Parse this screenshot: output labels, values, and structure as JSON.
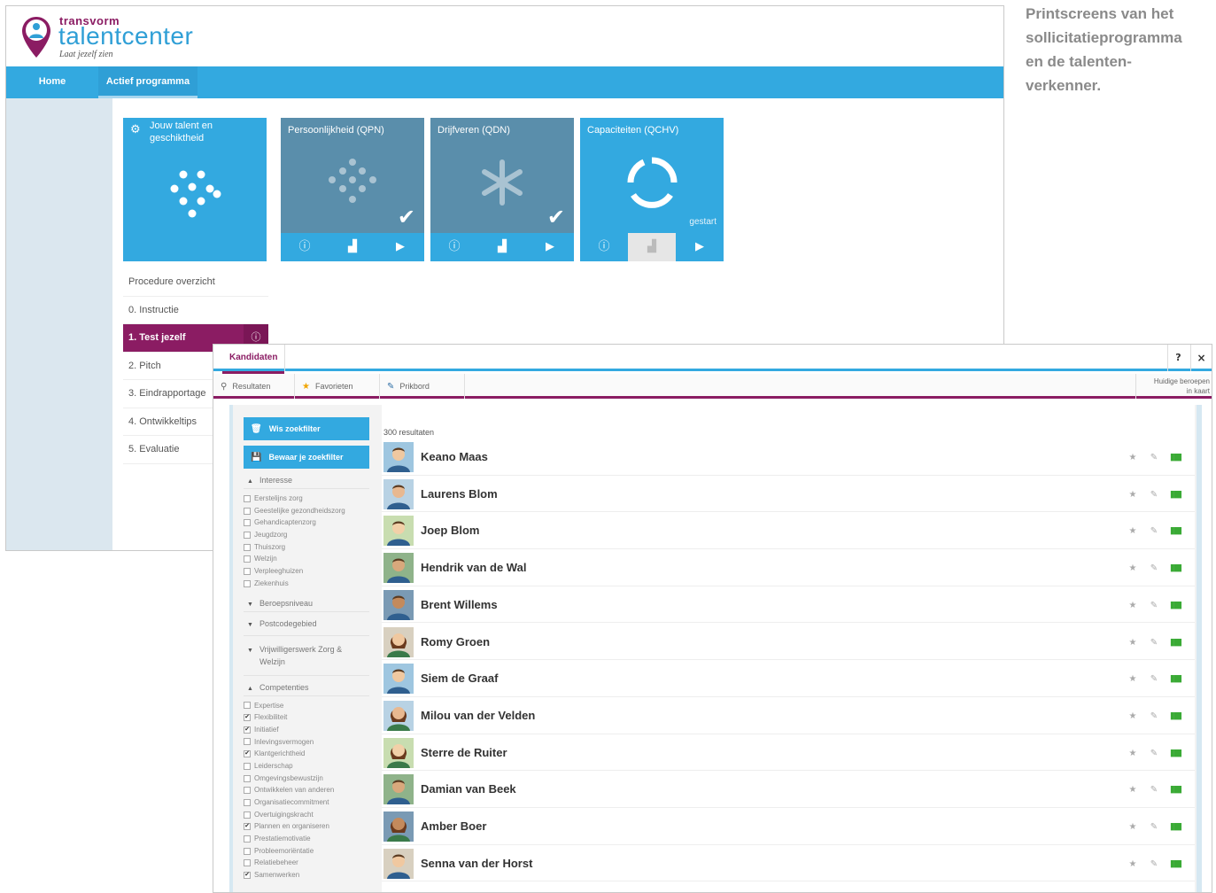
{
  "caption": {
    "lines": [
      "Printscreens van het",
      "sollicitatieprogramma",
      "en de talenten-",
      "verkenner."
    ]
  },
  "talentcenter": {
    "logo": {
      "small": "transvorm",
      "big": "talentcenter",
      "tagline": "Laat jezelf zien"
    },
    "nav": [
      {
        "label": "Home"
      },
      {
        "label": "Actief programma"
      }
    ],
    "main_tile": {
      "title": "Jouw talent en geschiktheid"
    },
    "tiles": [
      {
        "title": "Persoonlijkheid (QPN)",
        "status": "",
        "completed": true
      },
      {
        "title": "Drijfveren (QDN)",
        "status": "",
        "completed": true
      },
      {
        "title": "Capaciteiten (QCHV)",
        "status": "gestart",
        "completed": false
      }
    ],
    "steps": [
      {
        "label": "Procedure overzicht"
      },
      {
        "label": "0. Instructie"
      },
      {
        "label": "1. Test jezelf"
      },
      {
        "label": "2. Pitch"
      },
      {
        "label": "3. Eindrapportage"
      },
      {
        "label": "4. Ontwikkeltips"
      },
      {
        "label": "5. Evaluatie"
      }
    ],
    "colors": {
      "accent": "#33a9e0",
      "brand": "#8b1c63",
      "tile_done": "#5a8eab"
    }
  },
  "kandidaten": {
    "tab": "Kandidaten",
    "help": "?",
    "close": "×",
    "subtabs": [
      {
        "label": "Resultaten",
        "icon": "search-icon"
      },
      {
        "label": "Favorieten",
        "icon": "star-icon"
      },
      {
        "label": "Prikbord",
        "icon": "pin-icon"
      }
    ],
    "huidige": [
      "Huidige beroepen",
      "in kaart"
    ],
    "buttons": {
      "clear": "Wis zoekfilter",
      "save": "Bewaar je zoekfilter"
    },
    "filters": {
      "interesse": {
        "title": "Interesse",
        "items": [
          {
            "label": "Eerstelijns zorg",
            "checked": false
          },
          {
            "label": "Geestelijke gezondheidszorg",
            "checked": false
          },
          {
            "label": "Gehandicaptenzorg",
            "checked": false
          },
          {
            "label": "Jeugdzorg",
            "checked": false
          },
          {
            "label": "Thuiszorg",
            "checked": false
          },
          {
            "label": "Welzijn",
            "checked": false
          },
          {
            "label": "Verpleeghuizen",
            "checked": false
          },
          {
            "label": "Ziekenhuis",
            "checked": false
          }
        ]
      },
      "beroepsniveau": {
        "title": "Beroepsniveau"
      },
      "postcodegebied": {
        "title": "Postcodegebied"
      },
      "vrijwilligerswerk": {
        "title": "Vrijwilligerswerk Zorg & Welzijn"
      },
      "competenties": {
        "title": "Competenties",
        "items": [
          {
            "label": "Expertise",
            "checked": false
          },
          {
            "label": "Flexibiliteit",
            "checked": true
          },
          {
            "label": "Initiatief",
            "checked": true
          },
          {
            "label": "Inlevingsvermogen",
            "checked": false
          },
          {
            "label": "Klantgerichtheid",
            "checked": true
          },
          {
            "label": "Leiderschap",
            "checked": false
          },
          {
            "label": "Omgevingsbewustzijn",
            "checked": false
          },
          {
            "label": "Ontwikkelen van anderen",
            "checked": false
          },
          {
            "label": "Organisatiecommitment",
            "checked": false
          },
          {
            "label": "Overtuigingskracht",
            "checked": false
          },
          {
            "label": "Plannen en organiseren",
            "checked": true
          },
          {
            "label": "Prestatiemotivatie",
            "checked": false
          },
          {
            "label": "Probleemoriëntatie",
            "checked": false
          },
          {
            "label": "Relatiebeheer",
            "checked": false
          },
          {
            "label": "Samenwerken",
            "checked": true
          }
        ]
      }
    },
    "result_count": "300 resultaten",
    "candidates": [
      {
        "name": "Keano Maas",
        "avatar": "male"
      },
      {
        "name": "Laurens Blom",
        "avatar": "male"
      },
      {
        "name": "Joep Blom",
        "avatar": "male"
      },
      {
        "name": "Hendrik van de Wal",
        "avatar": "male"
      },
      {
        "name": "Brent Willems",
        "avatar": "male"
      },
      {
        "name": "Romy Groen",
        "avatar": "female"
      },
      {
        "name": "Siem de Graaf",
        "avatar": "male"
      },
      {
        "name": "Milou van der Velden",
        "avatar": "female"
      },
      {
        "name": "Sterre de Ruiter",
        "avatar": "female"
      },
      {
        "name": "Damian van Beek",
        "avatar": "male"
      },
      {
        "name": "Amber Boer",
        "avatar": "female"
      },
      {
        "name": "Senna van der Horst",
        "avatar": "male"
      }
    ]
  }
}
